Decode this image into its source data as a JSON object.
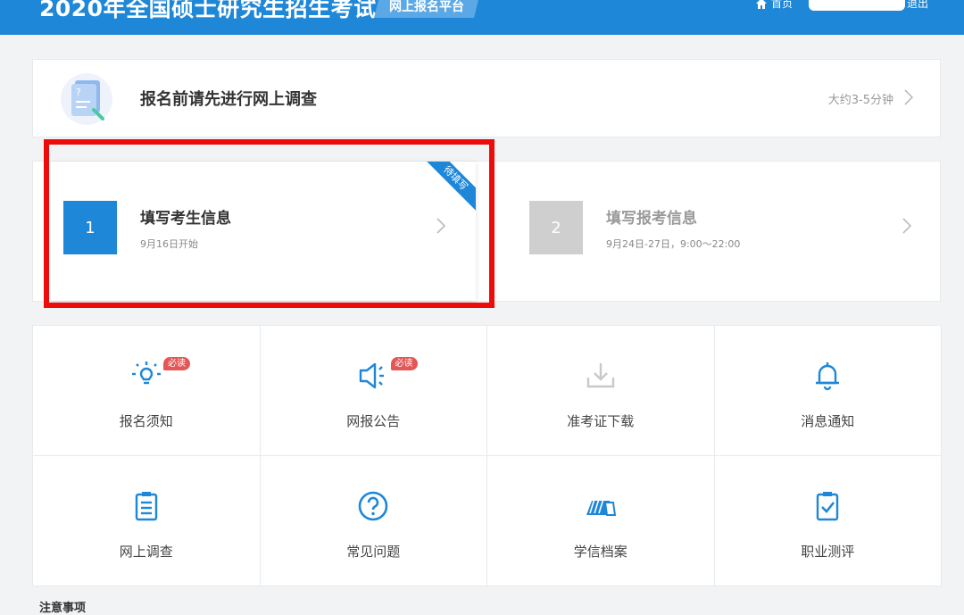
{
  "header": {
    "title": "2020年全国硕士研究生招生考试",
    "platform": "网上报名平台",
    "home": "首页",
    "logout": "退出",
    "bg_color": "#1e87d8"
  },
  "survey": {
    "text": "报名前请先进行网上调查",
    "time": "大约3-5分钟",
    "icon": "document-question-icon"
  },
  "steps": [
    {
      "number": "1",
      "title": "填写考生信息",
      "subtitle": "9月16日开始",
      "ribbon": "待填写",
      "active": true,
      "color": "#1e87d8"
    },
    {
      "number": "2",
      "title": "填写报考信息",
      "subtitle": "9月24日-27日，9:00～22:00",
      "active": false,
      "color": "#cfcfcf"
    }
  ],
  "grid": [
    {
      "label": "报名须知",
      "icon": "lightbulb-icon",
      "badge": "必读"
    },
    {
      "label": "网报公告",
      "icon": "megaphone-icon",
      "badge": "必读"
    },
    {
      "label": "准考证下载",
      "icon": "download-icon",
      "disabled": true
    },
    {
      "label": "消息通知",
      "icon": "bell-icon"
    },
    {
      "label": "网上调查",
      "icon": "clipboard-list-icon"
    },
    {
      "label": "常见问题",
      "icon": "question-circle-icon"
    },
    {
      "label": "学信档案",
      "icon": "folders-icon"
    },
    {
      "label": "职业测评",
      "icon": "clipboard-check-icon"
    }
  ],
  "notice": "注意事项",
  "colors": {
    "accent": "#1e87d8",
    "highlight": "#ec0c0c",
    "badge": "#e45757"
  }
}
